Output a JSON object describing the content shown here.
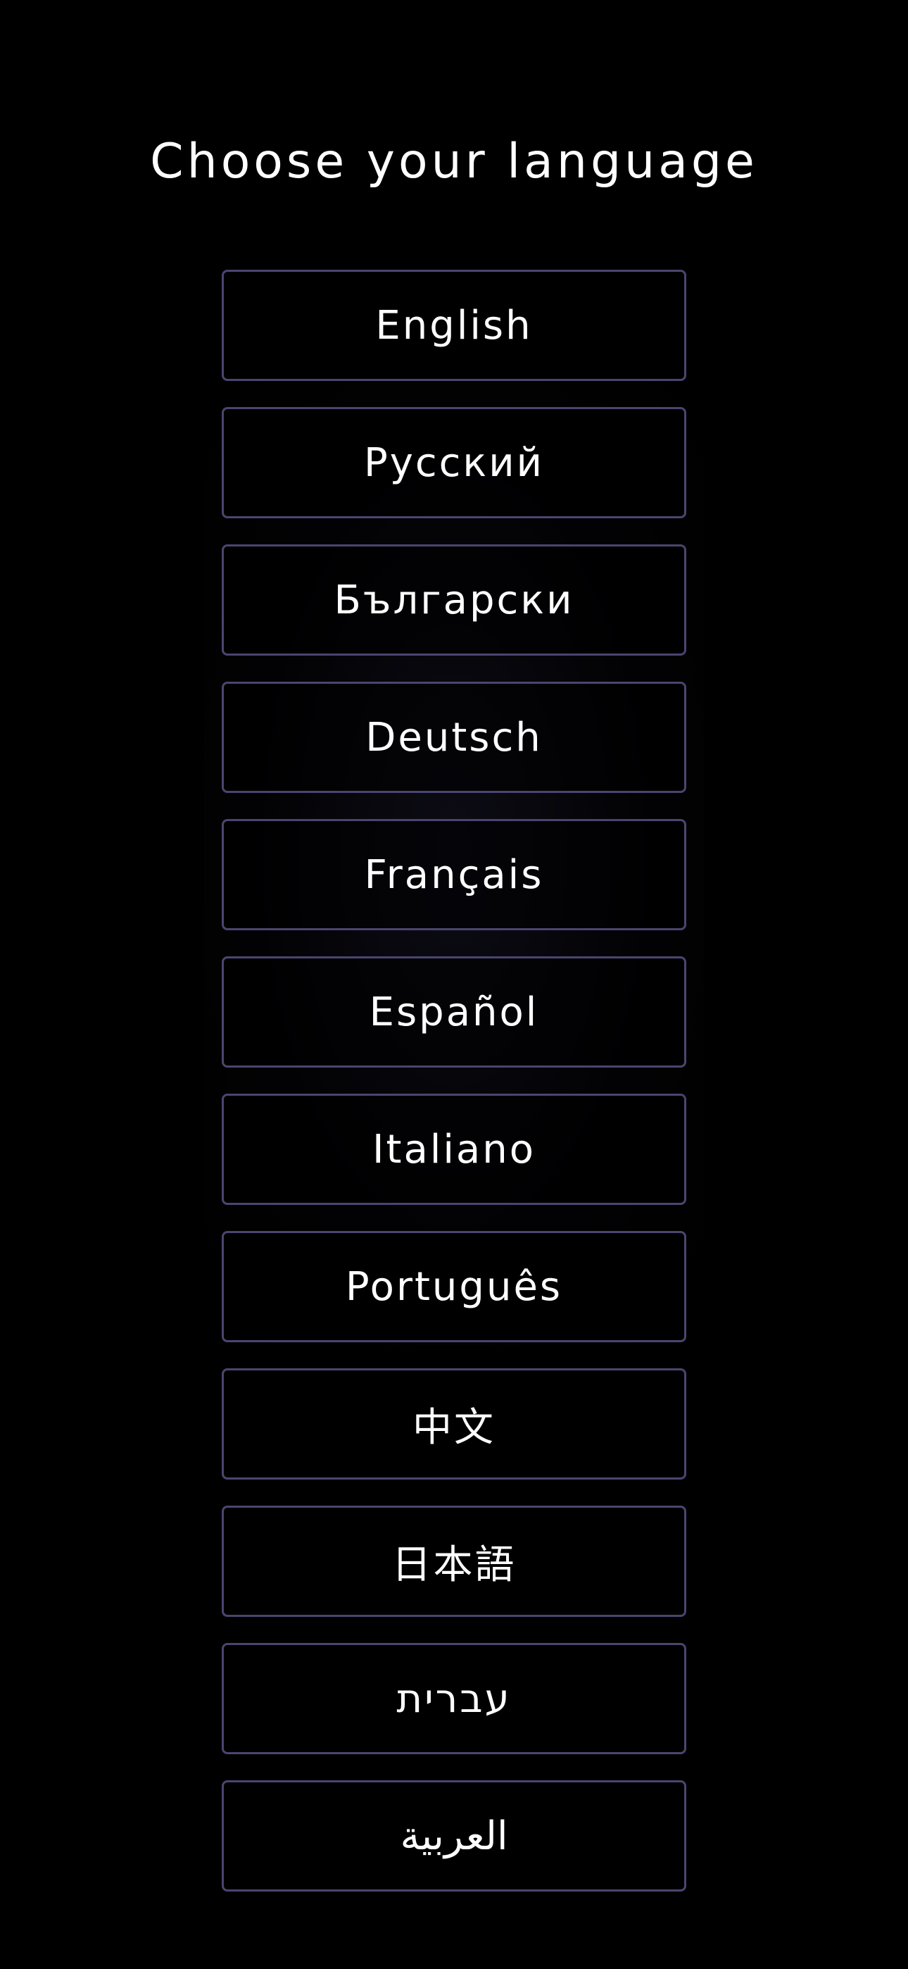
{
  "title": "Choose your language",
  "languages": [
    {
      "label": "English"
    },
    {
      "label": "Русский"
    },
    {
      "label": "Български"
    },
    {
      "label": "Deutsch"
    },
    {
      "label": "Français"
    },
    {
      "label": "Español"
    },
    {
      "label": "Italiano"
    },
    {
      "label": "Português"
    },
    {
      "label": "中文"
    },
    {
      "label": "日本語"
    },
    {
      "label": "עברית"
    },
    {
      "label": "العربية"
    }
  ],
  "colors": {
    "background": "#000000",
    "button_border": "#4b4570",
    "text": "#ffffff"
  }
}
